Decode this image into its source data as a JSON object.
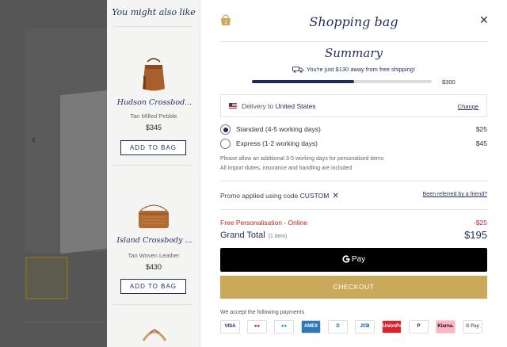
{
  "recommendations": {
    "title": "You might also like",
    "items": [
      {
        "name": "Hudson Crossbod...",
        "color": "Tan Milled Pebble",
        "price": "$345",
        "button": "ADD TO BAG"
      },
      {
        "name": "Island Crossbody ...",
        "color": "Tan Woven Leather",
        "price": "$430",
        "button": "ADD TO BAG"
      }
    ]
  },
  "bag": {
    "title": "Shopping bag",
    "close_icon": "close-icon",
    "bag_icon": "shopping-bag-icon"
  },
  "summary": {
    "title": "Summary",
    "free_shipping_text": "You're just $130 away from free shipping!",
    "free_shipping_threshold": "$300",
    "progress_fraction": 0.57,
    "delivery_label": "Delivery to",
    "delivery_country": "United States",
    "change_label": "Change",
    "shipping_options": [
      {
        "label": "Standard (4-5 working days)",
        "price": "$25",
        "selected": true
      },
      {
        "label": "Express (1-2 working days)",
        "price": "$45",
        "selected": false
      }
    ],
    "note_1": "Please allow an additional 3-5 working days for personalised items",
    "note_2": "All import duties, insurance and handling are included",
    "promo_prefix": "Promo applied using code",
    "promo_code": "CUSTOM",
    "referred_link": "Been referred by a friend?",
    "personalisation_label": "Free Personalisation - Online",
    "personalisation_amount": "-$25",
    "grand_total_label": "Grand Total",
    "grand_total_items": "(1 item)",
    "grand_total_amount": "$195",
    "gpay_label": "Pay",
    "checkout_label": "CHECKOUT",
    "accept_label": "We accept the following payments"
  },
  "payments": [
    {
      "label": "VISA",
      "color": "#1a1f71",
      "bg": "#ffffff"
    },
    {
      "label": "●●",
      "color": "#eb001b",
      "bg": "#ffffff"
    },
    {
      "label": "●●",
      "color": "#0099df",
      "bg": "#ffffff"
    },
    {
      "label": "AMEX",
      "color": "#ffffff",
      "bg": "#2e77bb"
    },
    {
      "label": "D",
      "color": "#0079be",
      "bg": "#ffffff"
    },
    {
      "label": "JCB",
      "color": "#0b4ea2",
      "bg": "#ffffff"
    },
    {
      "label": "UnionPay",
      "color": "#ffffff",
      "bg": "#d8262e"
    },
    {
      "label": "P",
      "color": "#003087",
      "bg": "#ffffff"
    },
    {
      "label": "Klarna.",
      "color": "#17120f",
      "bg": "#ffb3c7"
    },
    {
      "label": "G Pay",
      "color": "#5f6368",
      "bg": "#ffffff"
    }
  ],
  "colors": {
    "navy": "#1f2d5c",
    "gold": "#c9a95a",
    "red": "#b5261e"
  }
}
